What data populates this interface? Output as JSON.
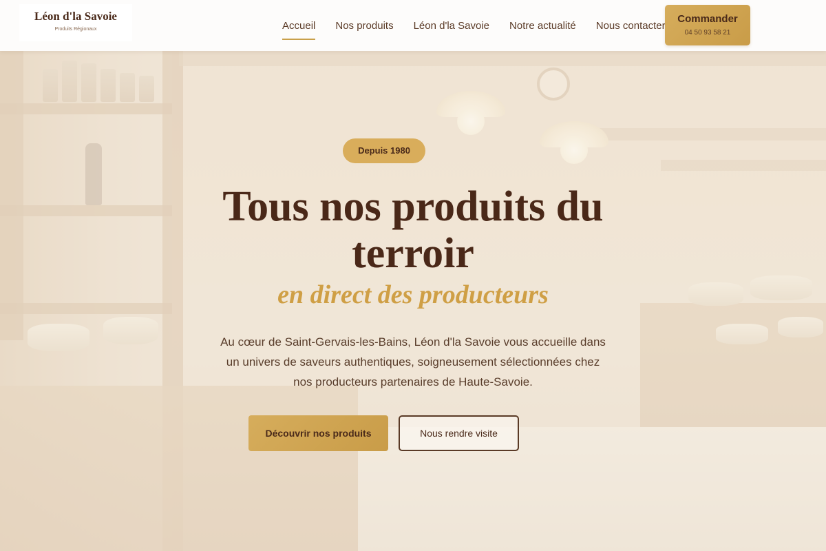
{
  "brand": {
    "name": "Léon d'la Savoie",
    "tagline": "Produits Régionaux"
  },
  "nav": {
    "items": [
      {
        "label": "Accueil",
        "active": true
      },
      {
        "label": "Nos produits",
        "active": false
      },
      {
        "label": "Léon d'la Savoie",
        "active": false
      },
      {
        "label": "Notre actualité",
        "active": false
      },
      {
        "label": "Nous contacter",
        "active": false
      }
    ]
  },
  "order": {
    "label": "Commander",
    "phone": "04 50 93 58 21"
  },
  "hero": {
    "badge": "Depuis 1980",
    "title_line1": "Tous nos produits du",
    "title_line2": "terroir",
    "subtitle": "en direct des producteurs",
    "lead_line1": "Au cœur de Saint-Gervais-les-Bains, Léon d'la Savoie vous accueille dans",
    "lead_line2": "un univers de saveurs authentiques, soigneusement sélectionnées chez",
    "lead_line3": "nos producteurs partenaires de Haute-Savoie.",
    "primary_cta": "Découvrir nos produits",
    "secondary_cta": "Nous rendre visite"
  },
  "colors": {
    "accent_gold": "#d6ad5c",
    "title_brown": "#4a2818",
    "subtitle_gold": "#cf9f45"
  }
}
